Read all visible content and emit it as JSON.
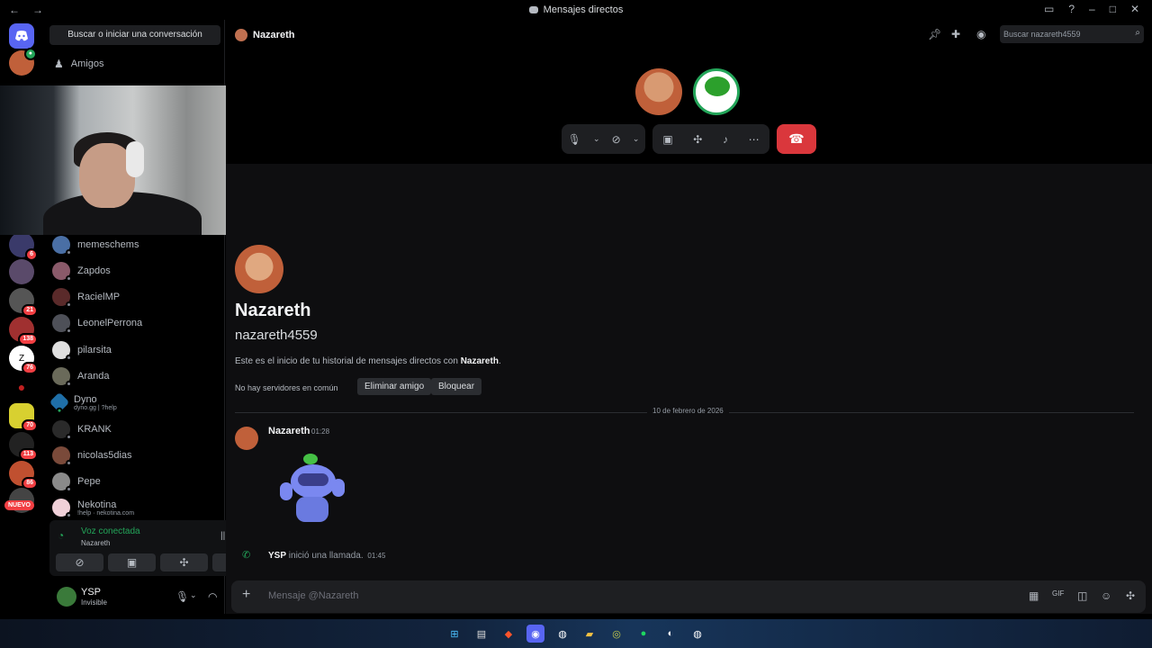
{
  "window": {
    "title": "Mensajes directos",
    "nav_back": "←",
    "nav_forward": "→"
  },
  "sidebar": {
    "search_label": "Buscar o iniciar una conversación",
    "friends_label": "Amigos",
    "dms": [
      {
        "name": "memeschems",
        "sub": "",
        "color": "#4a6fa5"
      },
      {
        "name": "Zapdos",
        "sub": "",
        "color": "#8a5a6a"
      },
      {
        "name": "RacielMP",
        "sub": "",
        "color": "#5a2a2a"
      },
      {
        "name": "LeonelPerrona",
        "sub": "",
        "color": "#4e5058"
      },
      {
        "name": "pilarsita",
        "sub": "",
        "color": "#e0e0e0"
      },
      {
        "name": "Aranda",
        "sub": "",
        "color": "#6a6a5a"
      },
      {
        "name": "Dyno",
        "sub": "dyno.gg | ?help",
        "color": "#1f6fa8"
      },
      {
        "name": "KRANK",
        "sub": "",
        "color": "#2a2a2a"
      },
      {
        "name": "nicolas5dias",
        "sub": "",
        "color": "#7a4a3a"
      },
      {
        "name": "Pepe",
        "sub": "",
        "color": "#8a8a8a"
      },
      {
        "name": "Nekotina",
        "sub": "!help · nekotina.com",
        "color": "#f0d0d8"
      }
    ]
  },
  "servers": {
    "badges": [
      "6",
      "21",
      "138",
      "76",
      "70",
      "113",
      "86"
    ],
    "nuevo": "NUEVO"
  },
  "voice": {
    "status": "Voz conectada",
    "channel": "Nazareth"
  },
  "user": {
    "name": "YSP",
    "status": "Invisible"
  },
  "header": {
    "name": "Nazareth",
    "search_placeholder": "Buscar nazareth4559"
  },
  "profile": {
    "display_name": "Nazareth",
    "username": "nazareth4559",
    "intro_prefix": "Este es el inicio de tu historial de mensajes directos con ",
    "intro_name": "Nazareth",
    "intro_suffix": ".",
    "no_servers": "No hay servidores en común",
    "remove_friend": "Eliminar amigo",
    "block": "Bloquear"
  },
  "chat": {
    "date_divider": "10 de febrero de 2026",
    "message_author": "Nazareth",
    "message_time": "01:28",
    "call_user": "YSP",
    "call_text": " inició una llamada.",
    "call_time": "01:45",
    "composer_placeholder": "Mensaje @Nazareth"
  },
  "colors": {
    "accent": "#5865f2",
    "green": "#23a559",
    "danger": "#da373c"
  }
}
